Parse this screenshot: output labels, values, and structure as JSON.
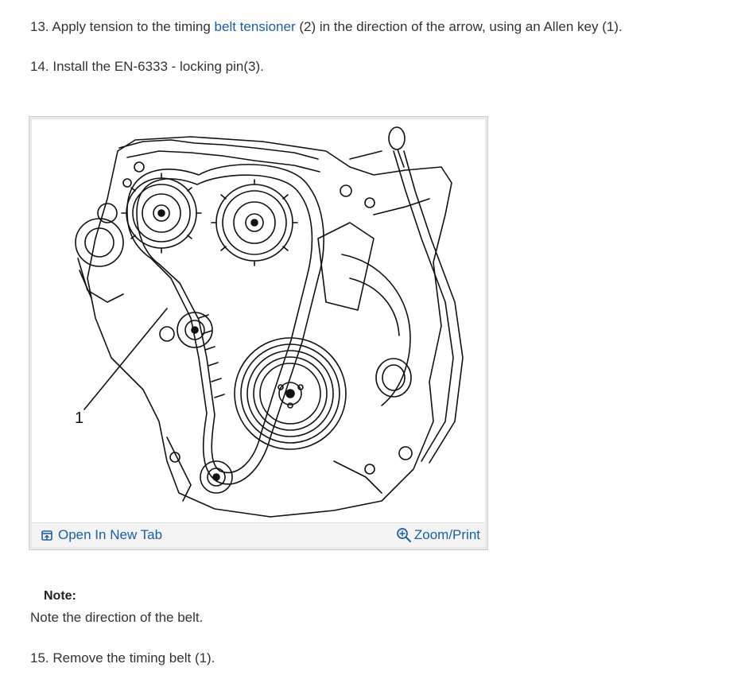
{
  "steps": {
    "step13": {
      "prefix": "13. Apply tension to the timing ",
      "link": "belt tensioner",
      "suffix": " (2) in the direction of the arrow, using an Allen key (1)."
    },
    "step14": {
      "text": "14. Install the EN-6333 - locking pin(3)."
    },
    "step15": {
      "text": "15. Remove the timing belt (1)."
    }
  },
  "figure": {
    "callout_label": "1",
    "open_tab_label": "Open In New Tab",
    "zoom_label": "Zoom/Print",
    "open_tab_icon": "open-in-new-tab-icon",
    "zoom_icon": "zoom-in-icon"
  },
  "note": {
    "heading": "Note:",
    "text": "Note the direction of the belt."
  },
  "colors": {
    "link": "#1a5ea8",
    "text": "#333333",
    "toolbar_bg": "#f4f4f4",
    "frame_bg": "#e9e9e9"
  }
}
